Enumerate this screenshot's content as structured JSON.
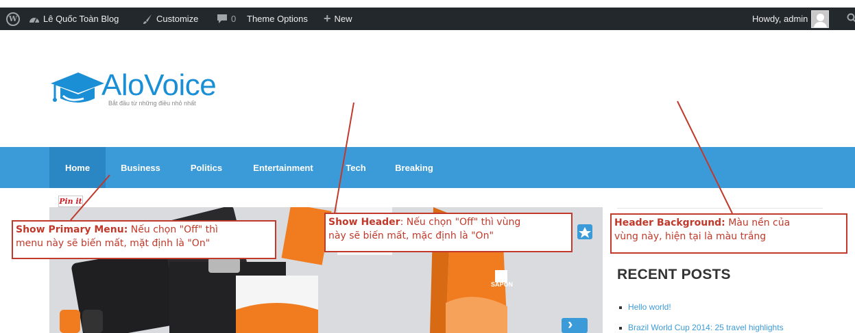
{
  "admin_bar": {
    "site_name": "Lê Quốc Toàn Blog",
    "customize_label": "Customize",
    "comments_count": "0",
    "theme_options_label": "Theme Options",
    "new_label": "New",
    "greeting": "Howdy, admin"
  },
  "header": {
    "logo_title": "AloVoice",
    "tagline": "Bắt đầu từ những điều nhỏ nhất"
  },
  "menu": {
    "items": [
      {
        "label": "Home"
      },
      {
        "label": "Business"
      },
      {
        "label": "Politics"
      },
      {
        "label": "Entertainment"
      },
      {
        "label": "Tech"
      },
      {
        "label": "Breaking"
      }
    ]
  },
  "content": {
    "pinit_label": "Pin it",
    "slider_brand": "SAPON",
    "next_arrow": "›"
  },
  "sidebar": {
    "recent_posts_title": "RECENT POSTS",
    "recent_posts": [
      {
        "title": "Hello world!"
      },
      {
        "title": "Brazil World Cup 2014: 25 travel highlights"
      }
    ]
  },
  "annotations": {
    "primary_menu": {
      "key": "Show Primary Menu:",
      "text_1": " Nếu chọn \"Off\" thì",
      "text_2": "menu này sẽ biến mất, mặt định là \"On\""
    },
    "show_header": {
      "key": "Show Header",
      "text_1": ": Nếu chọn \"Off\" thì vùng",
      "text_2": "này sẽ biến mất, mặc định là \"On\""
    },
    "header_background": {
      "key": "Header Background:",
      "text_1": " Màu nền của",
      "text_2": "vùng này, hiện tại là màu trắng"
    }
  },
  "colors": {
    "admin_bar_bg": "#23282d",
    "menu_bg": "#3b9bd8",
    "menu_active_bg": "#2b87c3",
    "logo_blue": "#1b8fd6",
    "annotation_red": "#c0392b",
    "slider_orange": "#f07c1f"
  },
  "icons": {
    "wordpress": "wordpress-logo-icon",
    "site": "dashboard-icon",
    "customize": "brush-icon",
    "comments": "comment-bubble-icon",
    "new": "plus-icon",
    "search": "search-icon"
  }
}
